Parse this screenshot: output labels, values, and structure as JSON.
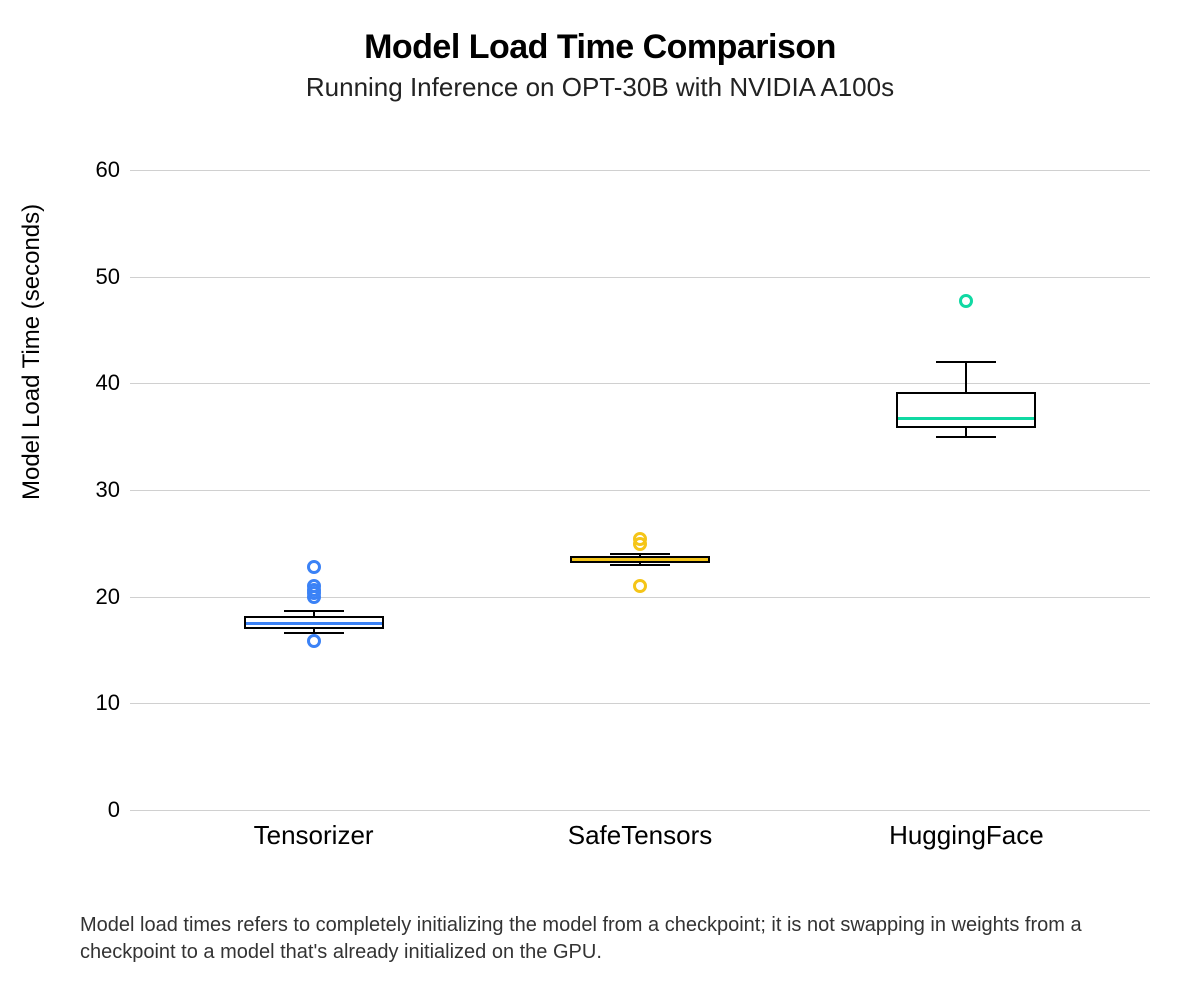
{
  "title": "Model Load Time Comparison",
  "subtitle": "Running Inference on OPT-30B with NVIDIA A100s",
  "ylabel": "Model Load Time (seconds)",
  "caption": "Model load times refers to completely initializing the model from a checkpoint; it is not swapping in weights from a checkpoint to a model that's already initialized on the GPU.",
  "chart_data": {
    "type": "box",
    "ylim": [
      0,
      60
    ],
    "yticks": [
      0,
      10,
      20,
      30,
      40,
      50,
      60
    ],
    "ylabel": "Model Load Time (seconds)",
    "categories": [
      "Tensorizer",
      "SafeTensors",
      "HuggingFace"
    ],
    "series": [
      {
        "name": "Tensorizer",
        "color": "#3B82F6",
        "q1": 17.0,
        "median": 17.5,
        "q3": 18.2,
        "whisker_low": 16.6,
        "whisker_high": 18.7,
        "outliers": [
          15.8,
          20.0,
          20.3,
          20.6,
          21.0,
          22.8
        ]
      },
      {
        "name": "SafeTensors",
        "color": "#F5C518",
        "q1": 23.2,
        "median": 23.5,
        "q3": 23.8,
        "whisker_low": 23.0,
        "whisker_high": 24.0,
        "outliers": [
          21.0,
          24.9,
          25.4
        ]
      },
      {
        "name": "HuggingFace",
        "color": "#10D9A3",
        "q1": 35.8,
        "median": 36.7,
        "q3": 39.2,
        "whisker_low": 35.0,
        "whisker_high": 42.0,
        "outliers": [
          47.7
        ]
      }
    ]
  }
}
